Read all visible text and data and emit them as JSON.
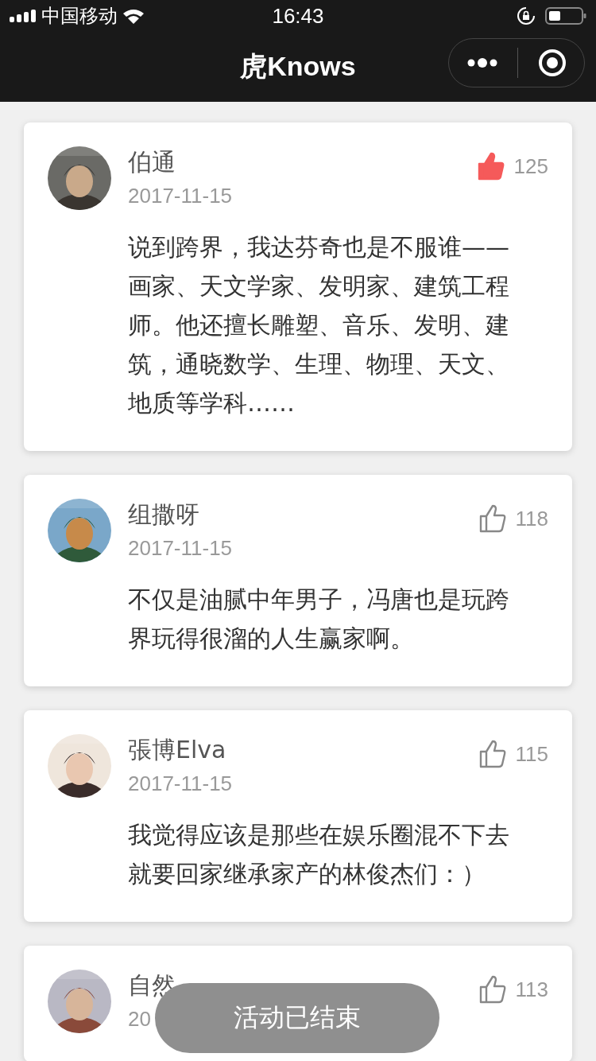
{
  "status_bar": {
    "carrier": "中国移动",
    "time": "16:43"
  },
  "header": {
    "title": "虎Knows"
  },
  "comments": [
    {
      "name": "伯通",
      "date": "2017-11-15",
      "liked": true,
      "likes": "125",
      "text": "说到跨界，我达芬奇也是不服谁——画家、天文学家、发明家、建筑工程师。他还擅长雕塑、音乐、发明、建筑，通晓数学、生理、物理、天文、地质等学科……"
    },
    {
      "name": "组撒呀",
      "date": "2017-11-15",
      "liked": false,
      "likes": "118",
      "text": "不仅是油腻中年男子，冯唐也是玩跨界玩得很溜的人生赢家啊。"
    },
    {
      "name": "張博Elva",
      "date": "2017-11-15",
      "liked": false,
      "likes": "115",
      "text": "我觉得应该是那些在娱乐圈混不下去就要回家继承家产的林俊杰们：）"
    },
    {
      "name": "自然",
      "date": "20",
      "liked": false,
      "likes": "113"
    }
  ],
  "toast": {
    "text": "活动已结束"
  }
}
